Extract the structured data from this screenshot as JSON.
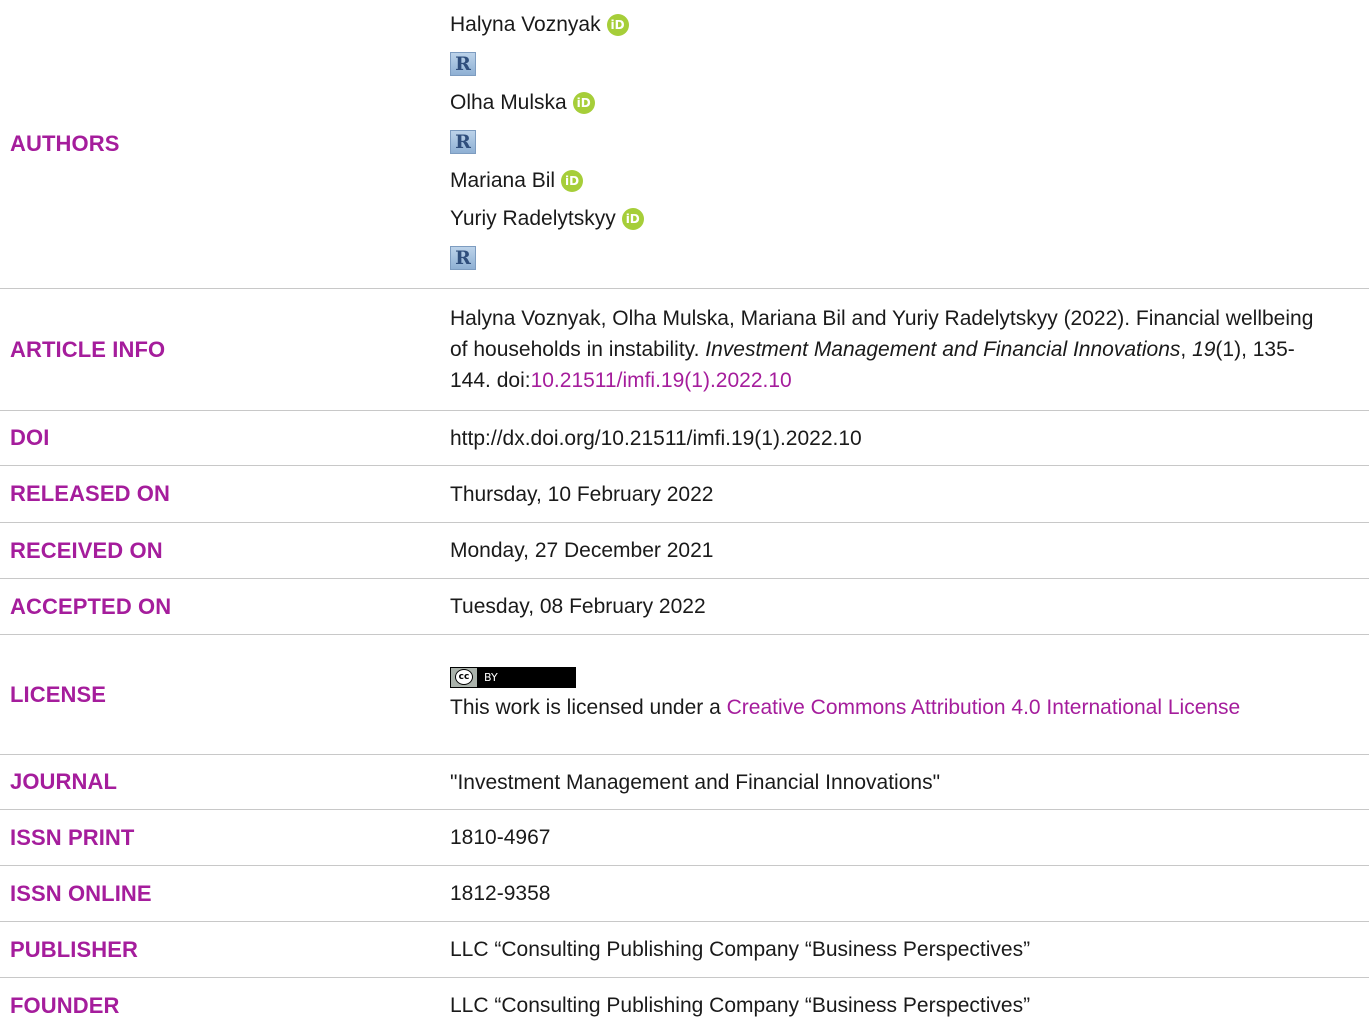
{
  "authors": {
    "label": "AUTHORS",
    "list": [
      {
        "name": "Halyna Voznyak",
        "orcid": true,
        "researcher_id": true
      },
      {
        "name": "Olha Mulska",
        "orcid": true,
        "researcher_id": true
      },
      {
        "name": "Mariana Bil",
        "orcid": true,
        "researcher_id": false
      },
      {
        "name": "Yuriy Radelytskyy",
        "orcid": true,
        "researcher_id": true
      }
    ],
    "orcid_icon_text": "iD",
    "researcher_icon_text": "R"
  },
  "article_info": {
    "label": "ARTICLE INFO",
    "citation_prefix": "Halyna Voznyak, Olha Mulska, Mariana Bil and Yuriy Radelytskyy (2022). Financial wellbeing of households in instability. ",
    "journal_italic": "Investment Management and Financial Innovations",
    "comma": ", ",
    "volume_italic": "19",
    "issue_pages": "(1), 135-144. doi:",
    "doi_link": "10.21511/imfi.19(1).2022.10"
  },
  "doi": {
    "label": "DOI",
    "value": "http://dx.doi.org/10.21511/imfi.19(1).2022.10"
  },
  "released_on": {
    "label": "RELEASED ON",
    "value": "Thursday, 10 February 2022"
  },
  "received_on": {
    "label": "RECEIVED ON",
    "value": "Monday, 27 December 2021"
  },
  "accepted_on": {
    "label": "ACCEPTED ON",
    "value": "Tuesday, 08 February 2022"
  },
  "license": {
    "label": "LICENSE",
    "badge_left": "cc",
    "badge_right": "BY",
    "text_prefix": "This work is licensed under a ",
    "link_text": "Creative Commons Attribution 4.0 International License"
  },
  "journal": {
    "label": "JOURNAL",
    "value": "\"Investment Management and Financial Innovations\""
  },
  "issn_print": {
    "label": "ISSN PRINT",
    "value": "1810-4967"
  },
  "issn_online": {
    "label": "ISSN ONLINE",
    "value": "1812-9358"
  },
  "publisher": {
    "label": "PUBLISHER",
    "value": "LLC “Consulting Publishing Company “Business Perspectives”"
  },
  "founder": {
    "label": "FOUNDER",
    "value": "LLC “Consulting Publishing Company “Business Perspectives”"
  },
  "colors": {
    "accent": "#a51d9c",
    "orcid_green": "#a6ce39",
    "divider": "#c8c8c8"
  }
}
